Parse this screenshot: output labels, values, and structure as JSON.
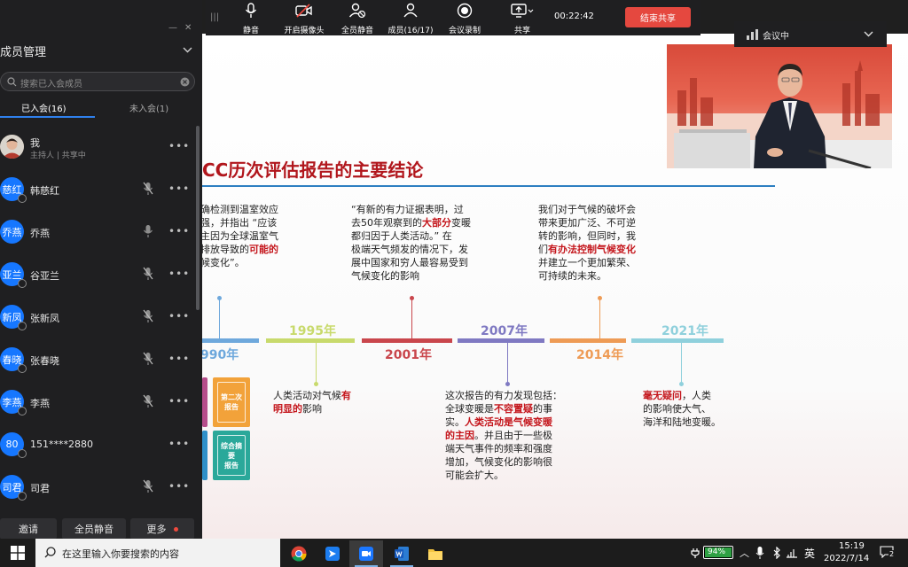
{
  "toolbar": {
    "items": [
      {
        "label": "静音",
        "icon": "microphone-icon"
      },
      {
        "label": "开启摄像头",
        "icon": "camera-off-icon"
      },
      {
        "label": "全员静音",
        "icon": "mute-all-icon"
      },
      {
        "label": "成员(16/17)",
        "icon": "members-icon"
      },
      {
        "label": "会议录制",
        "icon": "record-icon"
      },
      {
        "label": "共享",
        "icon": "share-screen-icon"
      }
    ],
    "timer": "00:22:42",
    "end_share": "结束共享"
  },
  "meeting_status": {
    "label": "会议中"
  },
  "panel": {
    "title": "成员管理",
    "search_placeholder": "搜索已入会成员",
    "tabs": [
      "已入会(16)",
      "未入会(1)"
    ],
    "members": [
      {
        "name": "我",
        "sub": "主持人 | 共享中",
        "avatar_text": "",
        "photo": true
      },
      {
        "name": "韩慈红",
        "avatar_text": "慈红"
      },
      {
        "name": "乔燕",
        "avatar_text": "乔燕"
      },
      {
        "name": "谷亚兰",
        "avatar_text": "亚兰"
      },
      {
        "name": "张新凤",
        "avatar_text": "新凤"
      },
      {
        "name": "张春晓",
        "avatar_text": "春晓"
      },
      {
        "name": "李燕",
        "avatar_text": "李燕"
      },
      {
        "name": "151****2880",
        "avatar_text": "80"
      },
      {
        "name": "司君",
        "avatar_text": "司君"
      }
    ],
    "buttons": {
      "invite": "邀请",
      "mute_all": "全员静音",
      "more": "更多"
    }
  },
  "slide": {
    "title": "CC历次评估报告的主要结论",
    "blocks": {
      "b1990_lines": [
        "确检测到温室效应",
        "强，并指出 “应该",
        "主因为全球温室气",
        "排放导致的",
        "候变化”。"
      ],
      "b1990_red": "可能的",
      "b2001_l1": "“有新的有力证据表明，过",
      "b2001_l2a": "去50年观察到的",
      "b2001_red": "大部分",
      "b2001_l2b": "变暖",
      "b2001_l3": "都归因于人类活动。”   在",
      "b2001_l4": "极端天气频发的情况下，发",
      "b2001_l5": "展中国家和穷人最容易受到",
      "b2001_l6": "气候变化的影响",
      "b2014_l1": "我们对于气候的破坏会",
      "b2014_l2": "带来更加广泛、不可逆",
      "b2014_l3": "转的影响，但同时，我",
      "b2014_l4a": "们",
      "b2014_red": "有办法控制气候变化",
      "b2014_l5": "并建立一个更加繁荣、",
      "b2014_l6": "可持续的未来。",
      "b1995_l1": "人类活动对气候",
      "b1995_red1": "有",
      "b1995_red2": "明显的",
      "b1995_l2": "影响",
      "b2007_l1": "这次报告的有力发现包括：",
      "b2007_l2a": "全球变暖是",
      "b2007_red1": "不容置疑",
      "b2007_l2b": "的事",
      "b2007_l3a": "实。",
      "b2007_red2": "人类活动是气候变暖",
      "b2007_red3": "的主因",
      "b2007_l4": "。并且由于一些极",
      "b2007_l5": "端天气事件的频率和强度",
      "b2007_l6": "增加，气候变化的影响很",
      "b2007_l7": "可能会扩大。",
      "b2021_red": "毫无疑问",
      "b2021_l1": "，人类",
      "b2021_l2": "的影响使大气、",
      "b2021_l3": "海洋和陆地变暖。"
    },
    "years": {
      "y1990": "990年",
      "y1995": "1995年",
      "y2001": "2001年",
      "y2007": "2007年",
      "y2014": "2014年",
      "y2021": "2021年"
    },
    "books": {
      "b1": "第二次\n报告",
      "b2": "综合摘要\n报告"
    }
  },
  "taskbar": {
    "search_placeholder": "在这里输入你要搜索的内容",
    "battery": "94%",
    "ime": "英",
    "time": "15:19",
    "date": "2022/7/14",
    "notifications": "2"
  }
}
